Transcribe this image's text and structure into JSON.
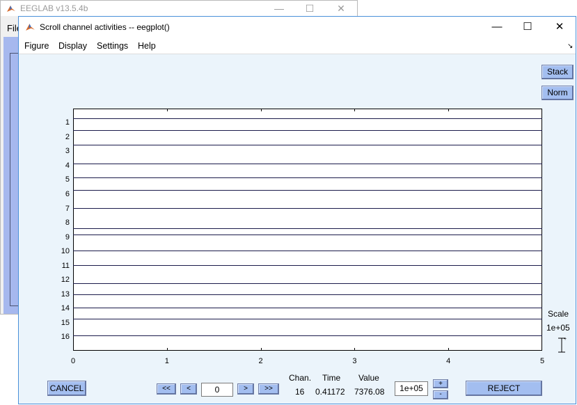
{
  "background_window": {
    "title": "EEGLAB v13.5.4b",
    "menu_first": "File",
    "controls": [
      "—",
      "☐",
      "✕"
    ]
  },
  "window": {
    "title": "Scroll channel activities -- eegplot()",
    "controls": {
      "minimize": "—",
      "maximize": "☐",
      "close": "✕"
    }
  },
  "menu": {
    "items": [
      "Figure",
      "Display",
      "Settings",
      "Help"
    ],
    "dock_glyph": "↘"
  },
  "side_buttons": {
    "stack": "Stack",
    "norm": "Norm"
  },
  "plot": {
    "channel_labels": [
      "1",
      "2",
      "3",
      "4",
      "5",
      "6",
      "7",
      "8",
      "9",
      "10",
      "11",
      "12",
      "13",
      "14",
      "15",
      "16"
    ],
    "x_ticks": [
      "0",
      "1",
      "2",
      "3",
      "4",
      "5"
    ]
  },
  "scale": {
    "label": "Scale",
    "value": "1e+05"
  },
  "controls": {
    "cancel": "CANCEL",
    "prev_page": "<<",
    "prev": "<",
    "position_value": "0",
    "next": ">",
    "next_page": ">>",
    "scale_input": "1e+05",
    "plus": "+",
    "minus": "-",
    "reject": "REJECT"
  },
  "readout": {
    "chan_label": "Chan.",
    "time_label": "Time",
    "value_label": "Value",
    "chan_value": "16",
    "time_value": "0.41172",
    "value_value": "7376.08"
  },
  "colors": {
    "window_bg": "#ebf4fb",
    "button_bg": "#a3bef0",
    "trace": "#1a1a4a"
  }
}
